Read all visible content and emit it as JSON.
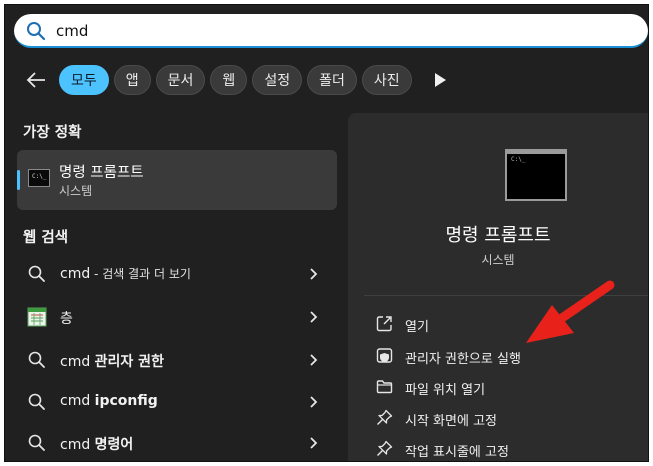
{
  "search": {
    "value": "cmd"
  },
  "filters": [
    {
      "label": "모두",
      "active": true
    },
    {
      "label": "앱"
    },
    {
      "label": "문서"
    },
    {
      "label": "웹"
    },
    {
      "label": "설정"
    },
    {
      "label": "폴더"
    },
    {
      "label": "사진"
    }
  ],
  "left": {
    "best_match_title": "가장 정확",
    "best_match": {
      "name": "명령 프롬프트",
      "sub": "시스템"
    },
    "web_search_title": "웹 검색",
    "results": [
      {
        "pre": "cmd",
        "rest": " - 검색 결과 더 보기",
        "icon": "search-icon"
      },
      {
        "pre": "",
        "rest": "층",
        "icon": "calendar-icon"
      },
      {
        "pre": "cmd ",
        "rest": "관리자 권한",
        "icon": "search-icon"
      },
      {
        "pre": "cmd ",
        "rest": "ipconfig",
        "icon": "search-icon"
      },
      {
        "pre": "cmd ",
        "rest": "명령어",
        "icon": "search-icon"
      }
    ]
  },
  "right": {
    "title": "명령 프롬프트",
    "sub": "시스템",
    "actions": [
      {
        "label": "열기",
        "icon": "open-external-icon"
      },
      {
        "label": "관리자 권한으로 실행",
        "icon": "shield-icon"
      },
      {
        "label": "파일 위치 열기",
        "icon": "folder-icon"
      },
      {
        "label": "시작 화면에 고정",
        "icon": "pin-icon"
      },
      {
        "label": "작업 표시줄에 고정",
        "icon": "pin-icon"
      }
    ]
  },
  "colors": {
    "accent": "#4cc2ff",
    "annotation_arrow": "#e8221a"
  }
}
